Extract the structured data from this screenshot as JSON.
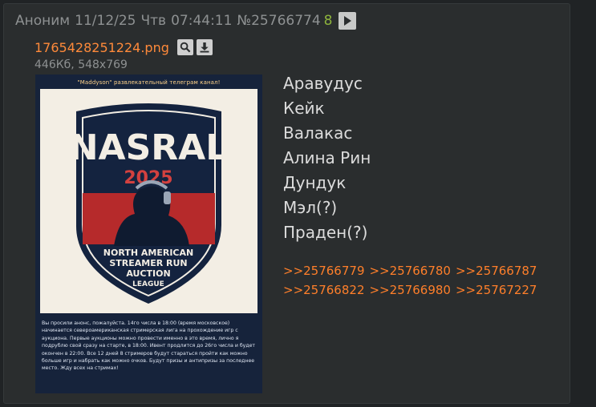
{
  "post": {
    "author": "Аноним",
    "date": "11/12/25",
    "weekday": "Чтв",
    "time": "07:44:11",
    "number": "№25766774",
    "reply_count": "8"
  },
  "file": {
    "name": "1765428251224.png",
    "size": "446Кб",
    "dimensions": "548x769",
    "icons": [
      "search-icon",
      "download-icon"
    ]
  },
  "thumbnail": {
    "banner": "\"Maddyson\" развлекательный телеграм канал!",
    "logo_title": "NASRAL",
    "logo_year": "2025",
    "logo_line1": "NORTH AMERICAN",
    "logo_line2": "STREAMER RUN",
    "logo_line3": "AUCTION",
    "logo_line4": "LEAGUE",
    "description": "Вы просили анонс, пожалуйста. 14го числа в 18:00 (время московское) начинается североамериканская стримерская лига на прохождение игр с аукциона. Первые аукционы можно провести именно в это время, лично я подрублю свой сразу на старте, в 18:00. Ивент продлится до 26го числа и будет окончен в 22:00. Все 12 дней 8 стримеров будут стараться пройти как можно больше игр и набрать как можно очков. Будут призы и антипризы за последнее место. Жду всех на стримах!"
  },
  "body": {
    "names": [
      "Аравудус",
      "Кейк",
      "Валакас",
      "Алина Рин",
      "Дундук",
      "Мэл(?)",
      "Праден(?)"
    ]
  },
  "replies": [
    [
      ">>25766779",
      ">>25766780",
      ">>25766787"
    ],
    [
      ">>25766822",
      ">>25766980",
      ">>25767227"
    ]
  ],
  "colors": {
    "background": "#202325",
    "post_background": "#2a2d2e",
    "accent_link": "#ff7f2a",
    "reply_count": "#8db33c",
    "logo_red": "#b62a2b",
    "logo_navy": "#14233f"
  }
}
